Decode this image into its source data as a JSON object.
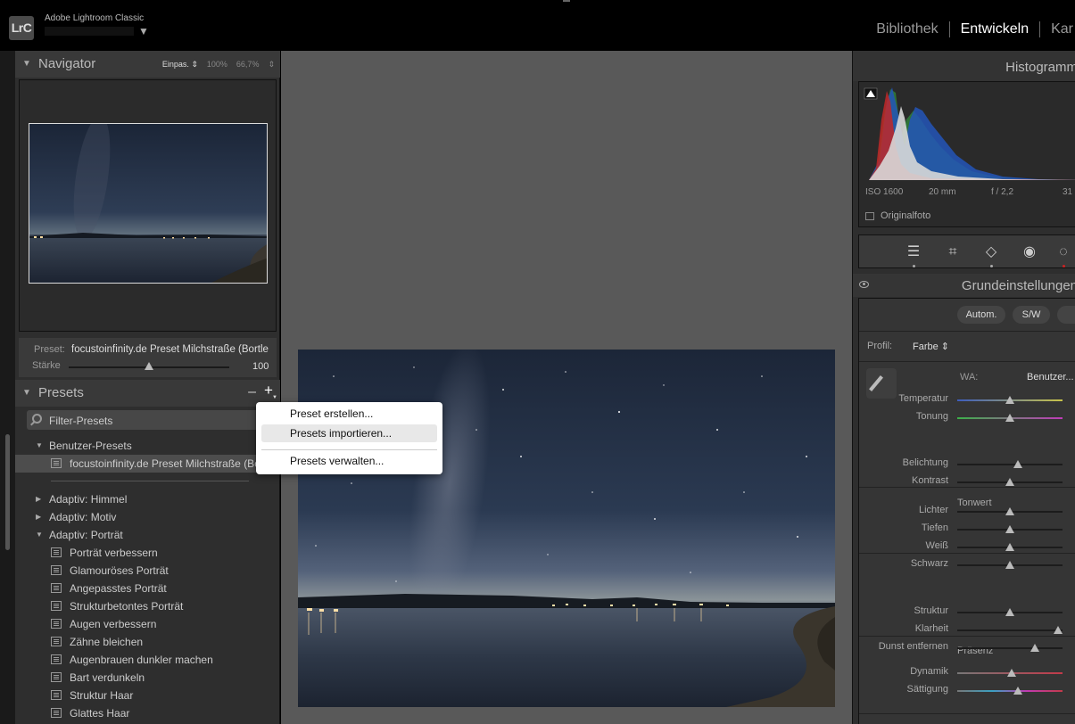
{
  "app": {
    "logo": "LrC",
    "title": "Adobe Lightroom Classic",
    "catalog_arrow": "▼"
  },
  "modules": [
    "Bibliothek",
    "Entwickeln",
    "Kar"
  ],
  "active_module": "Entwickeln",
  "navigator": {
    "title": "Navigator",
    "zoom": [
      "Einpas. ⇕",
      "100%",
      "66,7%",
      "⇕"
    ]
  },
  "preset_info": {
    "label": "Preset:",
    "value": "focustoinfinity.de Preset Milchstraße (Bortle",
    "amount_label": "Stärke",
    "amount_value": "100",
    "amount_fraction": 0.5
  },
  "presets": {
    "title": "Presets",
    "minus": "–",
    "plus": "+",
    "filter_placeholder": "Filter-Presets",
    "groups": [
      {
        "label": "Benutzer-Presets",
        "expanded": true
      },
      {
        "label": "focustoinfinity.de Preset Milchstraße (Bortle",
        "item": true,
        "selected": true
      },
      {
        "label": "Adaptiv: Himmel",
        "expanded": false
      },
      {
        "label": "Adaptiv: Motiv",
        "expanded": false
      },
      {
        "label": "Adaptiv: Porträt",
        "expanded": true
      },
      {
        "label": "Porträt verbessern",
        "item": true
      },
      {
        "label": "Glamouröses Porträt",
        "item": true
      },
      {
        "label": "Angepasstes Porträt",
        "item": true
      },
      {
        "label": "Strukturbetontes Porträt",
        "item": true
      },
      {
        "label": "Augen verbessern",
        "item": true
      },
      {
        "label": "Zähne bleichen",
        "item": true
      },
      {
        "label": "Augenbrauen dunkler machen",
        "item": true
      },
      {
        "label": "Bart verdunkeln",
        "item": true
      },
      {
        "label": "Struktur Haar",
        "item": true
      },
      {
        "label": "Glattes Haar",
        "item": true
      }
    ]
  },
  "context_menu": {
    "items": [
      "Preset erstellen...",
      "Presets importieren...",
      "Presets verwalten..."
    ],
    "hovered": 1
  },
  "histogram": {
    "title": "Histogramm",
    "iso": "ISO 1600",
    "focal": "20 mm",
    "aperture": "f / 2,2",
    "shutter": "31",
    "original_label": "Originalfoto"
  },
  "basic": {
    "title": "Grundeinstellungen",
    "auto": "Autom.",
    "bw": "S/W",
    "profile_label": "Profil:",
    "profile_value": "Farbe ⇕",
    "wb_label": "WA:",
    "wb_value": "Benutzer...",
    "tonwert": "Tonwert",
    "praesenz": "Präsenz",
    "sliders": [
      {
        "label": "Temperatur",
        "value": 0.5,
        "gradient": "linear-gradient(90deg,#3d5dbd,#c8c34a)"
      },
      {
        "label": "Tonung",
        "value": 0.5,
        "gradient": "linear-gradient(90deg,#3cb04a,#c03cb8)"
      },
      {
        "label": "Belichtung",
        "value": 0.58
      },
      {
        "label": "Kontrast",
        "value": 0.5
      },
      {
        "label": "Lichter",
        "value": 0.5
      },
      {
        "label": "Tiefen",
        "value": 0.5
      },
      {
        "label": "Weiß",
        "value": 0.5
      },
      {
        "label": "Schwarz",
        "value": 0.5
      },
      {
        "label": "Struktur",
        "value": 0.5
      },
      {
        "label": "Klarheit",
        "value": 0.96
      },
      {
        "label": "Dunst entfernen",
        "value": 0.74
      },
      {
        "label": "Dynamik",
        "value": 0.52,
        "gradient": "linear-gradient(90deg,#777,#c23a4a)"
      },
      {
        "label": "Sättigung",
        "value": 0.58,
        "gradient": "linear-gradient(90deg,#777,#3aa0c2,#c23ab0,#c23a4a)"
      }
    ]
  },
  "colors": {
    "accent_red": "#cc2222",
    "menu_bg": "#ffffff",
    "menu_hover": "#e8e8e8"
  }
}
